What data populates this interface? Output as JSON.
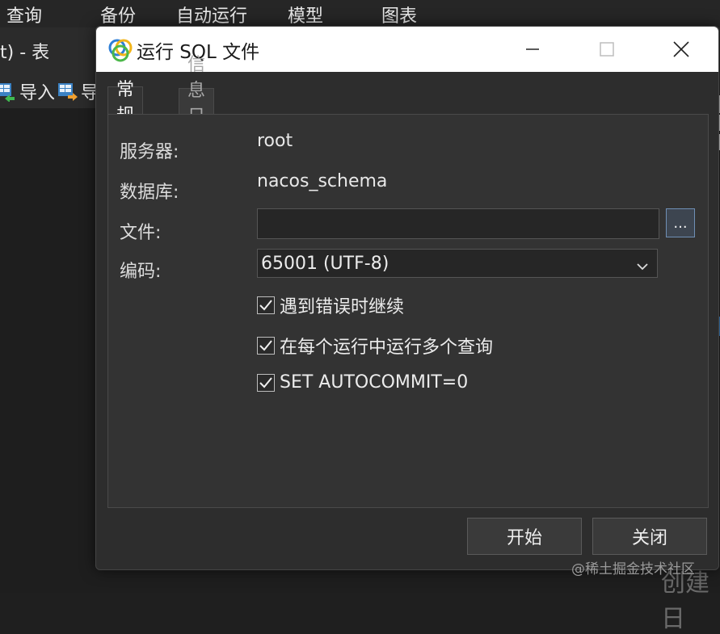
{
  "background": {
    "menu": [
      "查询",
      "备份",
      "自动运行",
      "模型",
      "图表"
    ],
    "tab_title": "t) - 表",
    "toolbar": {
      "import_label": "导入",
      "export_label": "导"
    },
    "bottom_text": "创建日"
  },
  "watermark": "@稀土掘金技术社区",
  "dialog": {
    "title": "运行 SQL 文件",
    "tabs": [
      {
        "label": "常规",
        "active": true
      },
      {
        "label": "信息日志",
        "active": false
      }
    ],
    "fields": {
      "server_label": "服务器:",
      "server_value": "root",
      "database_label": "数据库:",
      "database_value": "nacos_schema",
      "file_label": "文件:",
      "file_value": "",
      "browse_label": "...",
      "encoding_label": "编码:",
      "encoding_value": "65001 (UTF-8)"
    },
    "options": [
      {
        "label": "遇到错误时继续",
        "checked": true
      },
      {
        "label": "在每个运行中运行多个查询",
        "checked": true
      },
      {
        "label": "SET AUTOCOMMIT=0",
        "checked": true
      }
    ],
    "buttons": {
      "start": "开始",
      "close": "关闭"
    }
  },
  "colors": {
    "dialog_bg": "#2d2d2d",
    "panel_bg": "#333333",
    "titlebar_bg": "#ffffff",
    "browse_border": "#6f8fb5"
  }
}
